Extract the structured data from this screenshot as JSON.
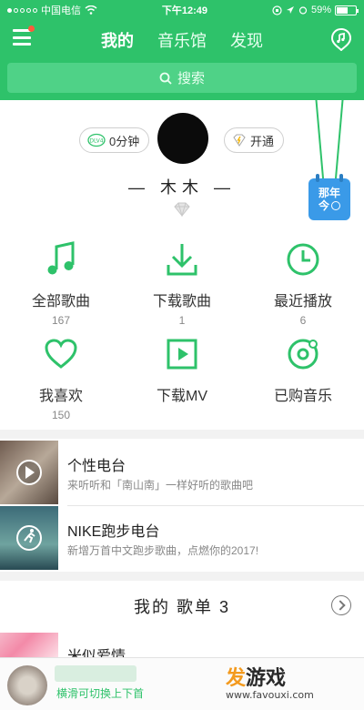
{
  "status_bar": {
    "carrier": "中国电信",
    "time": "下午12:49",
    "battery": "59%",
    "battery_level": 0.59
  },
  "header": {
    "tabs": [
      {
        "label": "我的",
        "active": true
      },
      {
        "label": "音乐馆",
        "active": false
      },
      {
        "label": "发现",
        "active": false
      }
    ],
    "search_placeholder": "搜索"
  },
  "profile": {
    "vip_label": "0分钟",
    "vip_badge": "DLV4",
    "open_label": "开通",
    "username": "— 木木 —",
    "calendar_line1": "那年",
    "calendar_line2": "今"
  },
  "grid": [
    {
      "icon": "music-note-icon",
      "label": "全部歌曲",
      "count": "167"
    },
    {
      "icon": "download-icon",
      "label": "下载歌曲",
      "count": "1"
    },
    {
      "icon": "clock-icon",
      "label": "最近播放",
      "count": "6"
    },
    {
      "icon": "heart-icon",
      "label": "我喜欢",
      "count": "150"
    },
    {
      "icon": "play-square-icon",
      "label": "下载MV",
      "count": ""
    },
    {
      "icon": "purchased-disc-icon",
      "label": "已购音乐",
      "count": ""
    }
  ],
  "radio": [
    {
      "title": "个性电台",
      "desc": "来听听和「南山南」一样好听的歌曲吧"
    },
    {
      "title": "NIKE跑步电台",
      "desc": "新增万首中文跑步歌曲，点燃你的2017!"
    }
  ],
  "playlists": {
    "header": "我的 歌单 3",
    "first_item": "米似爱情"
  },
  "player": {
    "hint": "横滑可切换上下首"
  },
  "watermark": {
    "logo_a": "发",
    "logo_b": "游戏",
    "url": "www.favouxi.com"
  },
  "colors": {
    "brand_green": "#2ec26a",
    "calendar_blue": "#3a9ae8"
  }
}
